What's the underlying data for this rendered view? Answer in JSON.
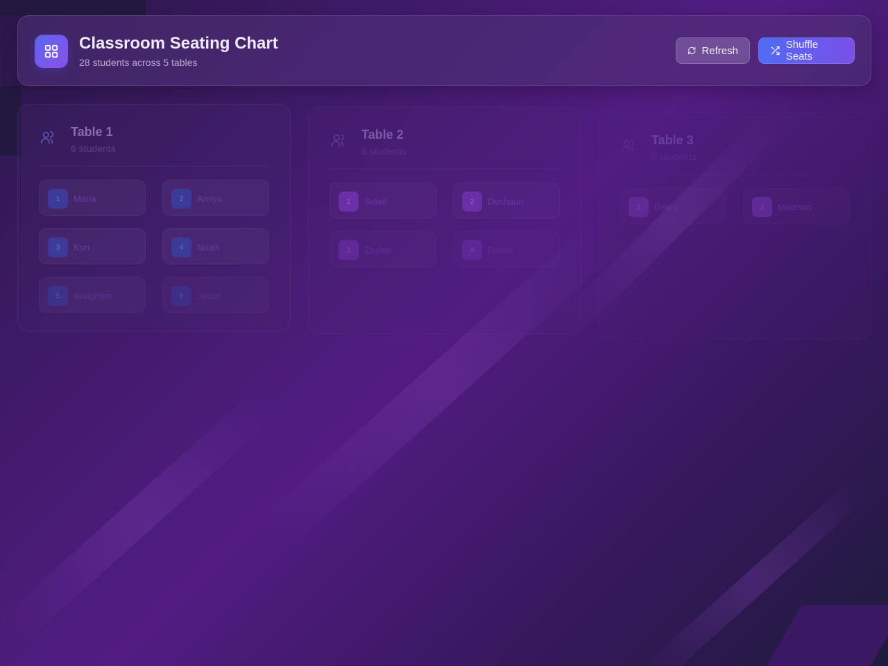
{
  "header": {
    "title": "Classroom Seating Chart",
    "subtitle": "28 students across 5 tables",
    "logo_icon": "grid-icon",
    "refresh_label": "Refresh",
    "refresh_icon": "refresh-icon",
    "shuffle_label": "Shuffle Seats",
    "shuffle_icon": "shuffle-icon"
  },
  "tables": [
    {
      "title": "Table 1",
      "count_label": "6 students",
      "icon": "users-icon",
      "seats": [
        {
          "num": "1",
          "name": "Maria"
        },
        {
          "num": "2",
          "name": "Amiya"
        },
        {
          "num": "3",
          "name": "Kori"
        },
        {
          "num": "4",
          "name": "Noah"
        },
        {
          "num": "5",
          "name": "Braighton"
        },
        {
          "num": "6",
          "name": "Jason"
        }
      ]
    },
    {
      "title": "Table 2",
      "count_label": "6 students",
      "icon": "users-icon",
      "seats": [
        {
          "num": "1",
          "name": "Soleil"
        },
        {
          "num": "2",
          "name": "Deshaun"
        },
        {
          "num": "3",
          "name": "Zaylan"
        },
        {
          "num": "4",
          "name": "Dallas"
        }
      ]
    },
    {
      "title": "Table 3",
      "count_label": "6 students",
      "icon": "users-icon",
      "seats": [
        {
          "num": "1",
          "name": "Grace"
        },
        {
          "num": "2",
          "name": "Madison"
        }
      ]
    }
  ],
  "colors": {
    "accent_blue": "#4f6cf2",
    "accent_purple": "#7b4fe8",
    "background": "#521c82"
  }
}
